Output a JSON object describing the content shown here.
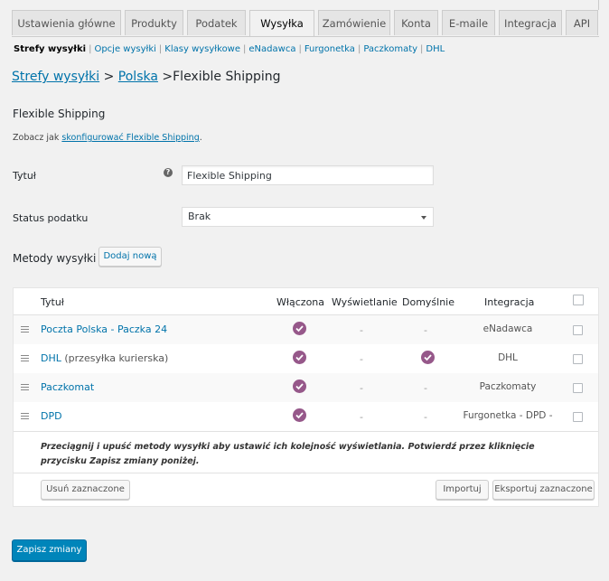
{
  "tabs": [
    {
      "label": "Ustawienia główne"
    },
    {
      "label": "Produkty"
    },
    {
      "label": "Podatek"
    },
    {
      "label": "Wysyłka"
    },
    {
      "label": "Zamówienie"
    },
    {
      "label": "Konta"
    },
    {
      "label": "E-maile"
    },
    {
      "label": "Integracja"
    },
    {
      "label": "API"
    }
  ],
  "subnav": [
    {
      "label": "Strefy wysyłki"
    },
    {
      "label": "Opcje wysyłki"
    },
    {
      "label": "Klasy wysyłkowe"
    },
    {
      "label": "eNadawca"
    },
    {
      "label": "Furgonetka"
    },
    {
      "label": "Paczkomaty"
    },
    {
      "label": "DHL"
    }
  ],
  "breadcrumb": {
    "zones": "Strefy wysyłki",
    "sep1": " > ",
    "country": "Polska",
    "sep2": " >",
    "current": "Flexible Shipping"
  },
  "section": {
    "title": "Flexible Shipping",
    "desc_prefix": "Zobacz jak ",
    "desc_link": "skonfigurować Flexible Shipping",
    "desc_suffix": "."
  },
  "form": {
    "title_label": "Tytuł",
    "title_value": "Flexible Shipping",
    "help_glyph": "?",
    "tax_label": "Status podatku",
    "tax_value": "Brak"
  },
  "methods": {
    "label": "Metody wysyłki",
    "add_button": "Dodaj nową",
    "headers": {
      "title": "Tytuł",
      "enabled": "Włączona",
      "display": "Wyświetlanie",
      "default": "Domyślnie",
      "integration": "Integracja"
    },
    "rows": [
      {
        "name": "Poczta Polska - Paczka 24",
        "extra": "",
        "enabled": true,
        "display": "-",
        "default": false,
        "default_text": "-",
        "integration": "eNadawca"
      },
      {
        "name": "DHL",
        "extra": " (przesyłka kurierska)",
        "enabled": true,
        "display": "-",
        "default": true,
        "default_text": "",
        "integration": "DHL"
      },
      {
        "name": "Paczkomat",
        "extra": "",
        "enabled": true,
        "display": "-",
        "default": false,
        "default_text": "-",
        "integration": "Paczkomaty"
      },
      {
        "name": "DPD",
        "extra": "",
        "enabled": true,
        "display": "-",
        "default": false,
        "default_text": "-",
        "integration": "Furgonetka - DPD -"
      }
    ],
    "note": "Przeciągnij i upuść metody wysyłki aby ustawić ich kolejność wyświetlania. Potwierdź przez kliknięcie przycisku Zapisz zmiany poniżej.",
    "delete_button": "Usuń zaznaczone",
    "import_button": "Importuj",
    "export_button": "Eksportuj zaznaczone"
  },
  "save_button": "Zapisz zmiany",
  "colors": {
    "accent": "#0073aa",
    "check": "#96588a",
    "primary": "#0085ba"
  }
}
